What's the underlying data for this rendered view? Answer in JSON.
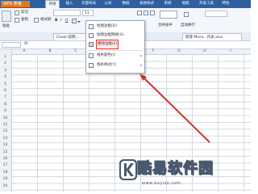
{
  "app": {
    "name": "WPS 表格"
  },
  "menu_tabs": [
    {
      "label": "开始"
    },
    {
      "label": "插入"
    },
    {
      "label": "页面布局"
    },
    {
      "label": "公式"
    },
    {
      "label": "数据"
    },
    {
      "label": "表格样式"
    },
    {
      "label": "审阅"
    },
    {
      "label": "视图"
    },
    {
      "label": "开发工具"
    },
    {
      "label": "特色"
    }
  ],
  "ribbon": {
    "paste_label": "粘贴",
    "cut_label": "剪切",
    "copy_label": "复制",
    "format_label": "格式刷",
    "font_size": "11",
    "merge_label": "合并居中",
    "wrap_label": "自动换行"
  },
  "doc_tabs": [
    {
      "label": "Cover-说明..."
    },
    {
      "label": "新建 Micro...作表.xlsx"
    }
  ],
  "dropdown_menu": {
    "items": [
      {
        "label": "绘图边框(D)"
      },
      {
        "label": "绘图边框网格(G)"
      },
      {
        "label": "擦除边框(E)"
      },
      {
        "label": "线条颜色(I)"
      },
      {
        "label": "线条样式(Y)"
      }
    ],
    "selected_index": 2
  },
  "rows": [
    "1",
    "2",
    "3",
    "4",
    "5",
    "6",
    "7",
    "8",
    "9",
    "10",
    "11",
    "12",
    "13",
    "14",
    "15",
    "16",
    "17",
    "18",
    "19",
    "20",
    "21"
  ],
  "columns": [
    "A",
    "B",
    "C",
    "D",
    "E",
    "F",
    "G",
    "H",
    "I"
  ],
  "watermark": {
    "text": "酷易软件园",
    "url": "www.kuyiso.com"
  }
}
